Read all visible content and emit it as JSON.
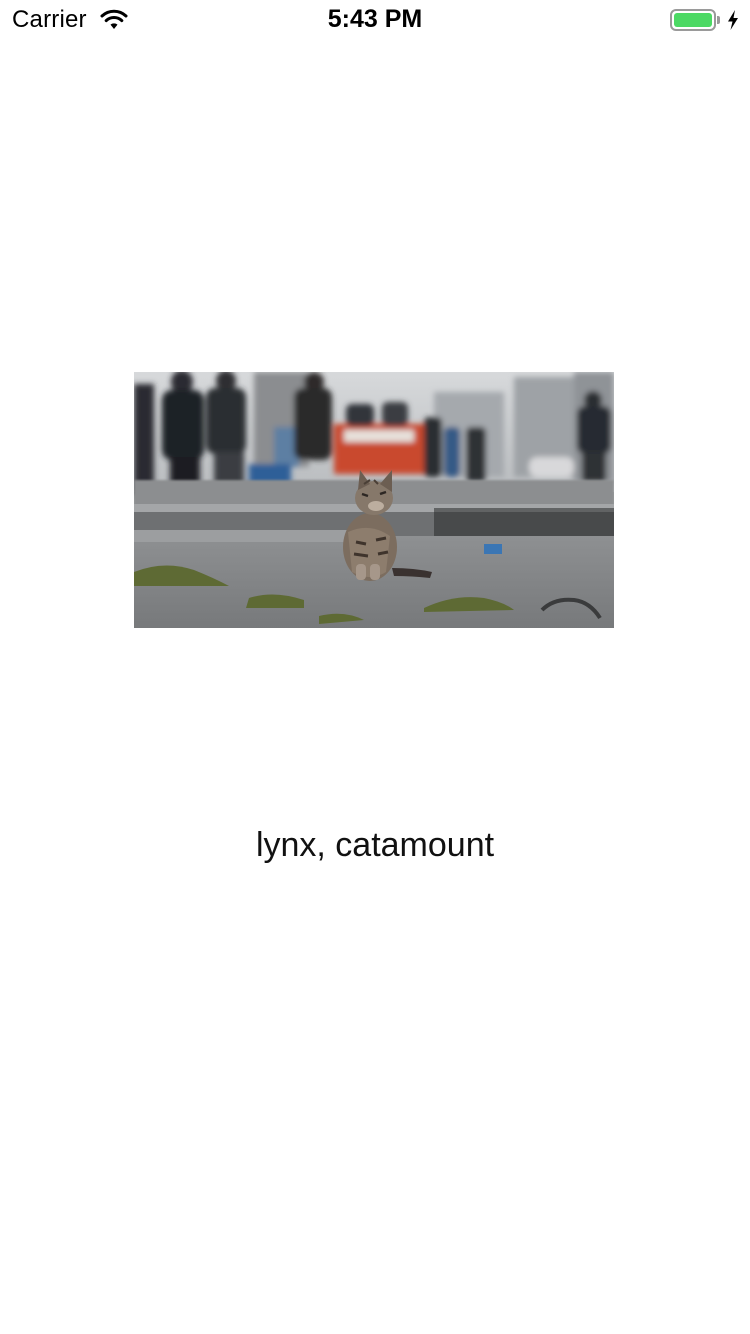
{
  "status_bar": {
    "carrier": "Carrier",
    "time": "5:43 PM",
    "battery_level": 1.0,
    "battery_color": "#4cd964",
    "charging": true,
    "icons": [
      "wifi-icon",
      "battery-icon",
      "charging-bolt-icon"
    ]
  },
  "image": {
    "subject": "cat-photo"
  },
  "prediction": {
    "label": "lynx, catamount"
  }
}
